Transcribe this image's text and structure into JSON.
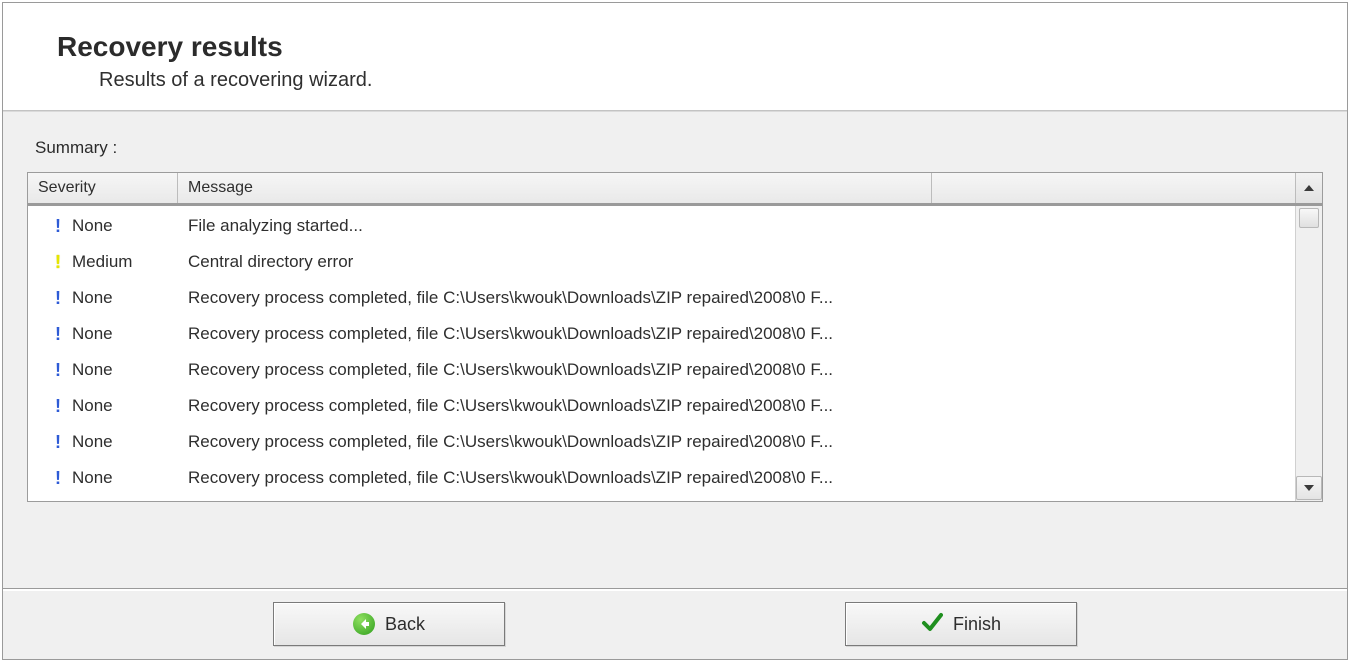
{
  "header": {
    "title": "Recovery results",
    "subtitle": "Results of a recovering wizard."
  },
  "summary_label": "Summary :",
  "table": {
    "columns": {
      "severity": "Severity",
      "message": "Message"
    },
    "rows": [
      {
        "severity": "None",
        "icon": "info",
        "message": "File analyzing started..."
      },
      {
        "severity": "Medium",
        "icon": "warn",
        "message": "Central directory error"
      },
      {
        "severity": "None",
        "icon": "info",
        "message": "Recovery process completed, file C:\\Users\\kwouk\\Downloads\\ZIP repaired\\2008\\0 F..."
      },
      {
        "severity": "None",
        "icon": "info",
        "message": "Recovery process completed, file C:\\Users\\kwouk\\Downloads\\ZIP repaired\\2008\\0 F..."
      },
      {
        "severity": "None",
        "icon": "info",
        "message": "Recovery process completed, file C:\\Users\\kwouk\\Downloads\\ZIP repaired\\2008\\0 F..."
      },
      {
        "severity": "None",
        "icon": "info",
        "message": "Recovery process completed, file C:\\Users\\kwouk\\Downloads\\ZIP repaired\\2008\\0 F..."
      },
      {
        "severity": "None",
        "icon": "info",
        "message": "Recovery process completed, file C:\\Users\\kwouk\\Downloads\\ZIP repaired\\2008\\0 F..."
      },
      {
        "severity": "None",
        "icon": "info",
        "message": "Recovery process completed, file C:\\Users\\kwouk\\Downloads\\ZIP repaired\\2008\\0 F..."
      }
    ]
  },
  "buttons": {
    "back": "Back",
    "finish": "Finish"
  }
}
